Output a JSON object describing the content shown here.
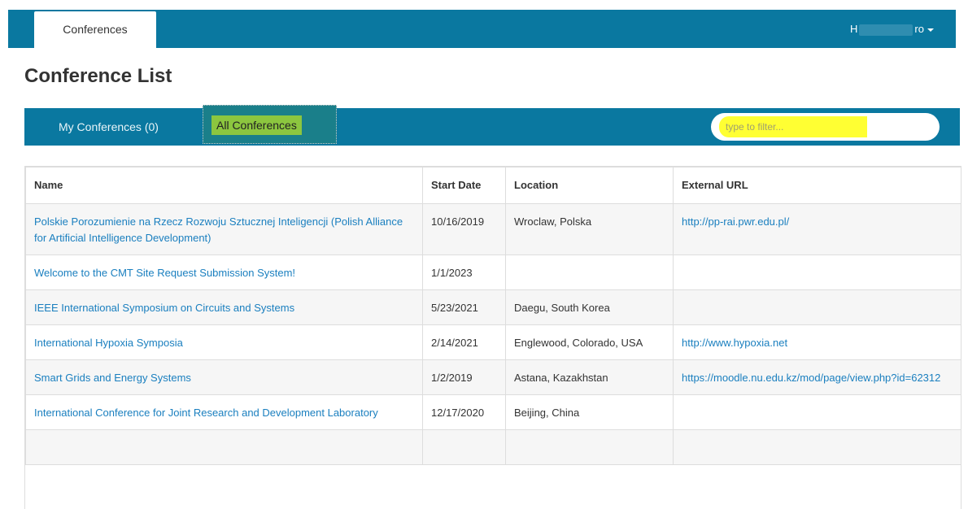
{
  "topbar": {
    "tab_label": "Conferences",
    "user_initial": "H",
    "user_suffix": "ro"
  },
  "page": {
    "title": "Conference List"
  },
  "subnav": {
    "my_conferences": "My Conferences (0)",
    "all_conferences": "All Conferences",
    "filter_placeholder": "type to filter..."
  },
  "table": {
    "headers": [
      "Name",
      "Start Date",
      "Location",
      "External URL"
    ],
    "rows": [
      {
        "name": "Polskie Porozumienie na Rzecz Rozwoju Sztucznej Inteligencji (Polish Alliance for Artificial Intelligence Development)",
        "start_date": "10/16/2019",
        "location": "Wroclaw, Polska",
        "url": "http://pp-rai.pwr.edu.pl/"
      },
      {
        "name": "Welcome to the CMT Site Request Submission System!",
        "start_date": "1/1/2023",
        "location": "",
        "url": ""
      },
      {
        "name": "IEEE International Symposium on Circuits and Systems",
        "start_date": "5/23/2021",
        "location": "Daegu, South Korea",
        "url": ""
      },
      {
        "name": "International Hypoxia Symposia",
        "start_date": "2/14/2021",
        "location": "Englewood, Colorado, USA",
        "url": "http://www.hypoxia.net"
      },
      {
        "name": "Smart Grids and Energy Systems",
        "start_date": "1/2/2019",
        "location": "Astana, Kazakhstan",
        "url": "https://moodle.nu.edu.kz/mod/page/view.php?id=62312"
      },
      {
        "name": "International Conference for Joint Research and Development Laboratory",
        "start_date": "12/17/2020",
        "location": "Beijing, China",
        "url": ""
      }
    ]
  },
  "colors": {
    "brand_bar": "#0a78a0",
    "link": "#1a7fbf",
    "highlight_green": "#8cc63f",
    "highlight_yellow": "#ffff33"
  }
}
